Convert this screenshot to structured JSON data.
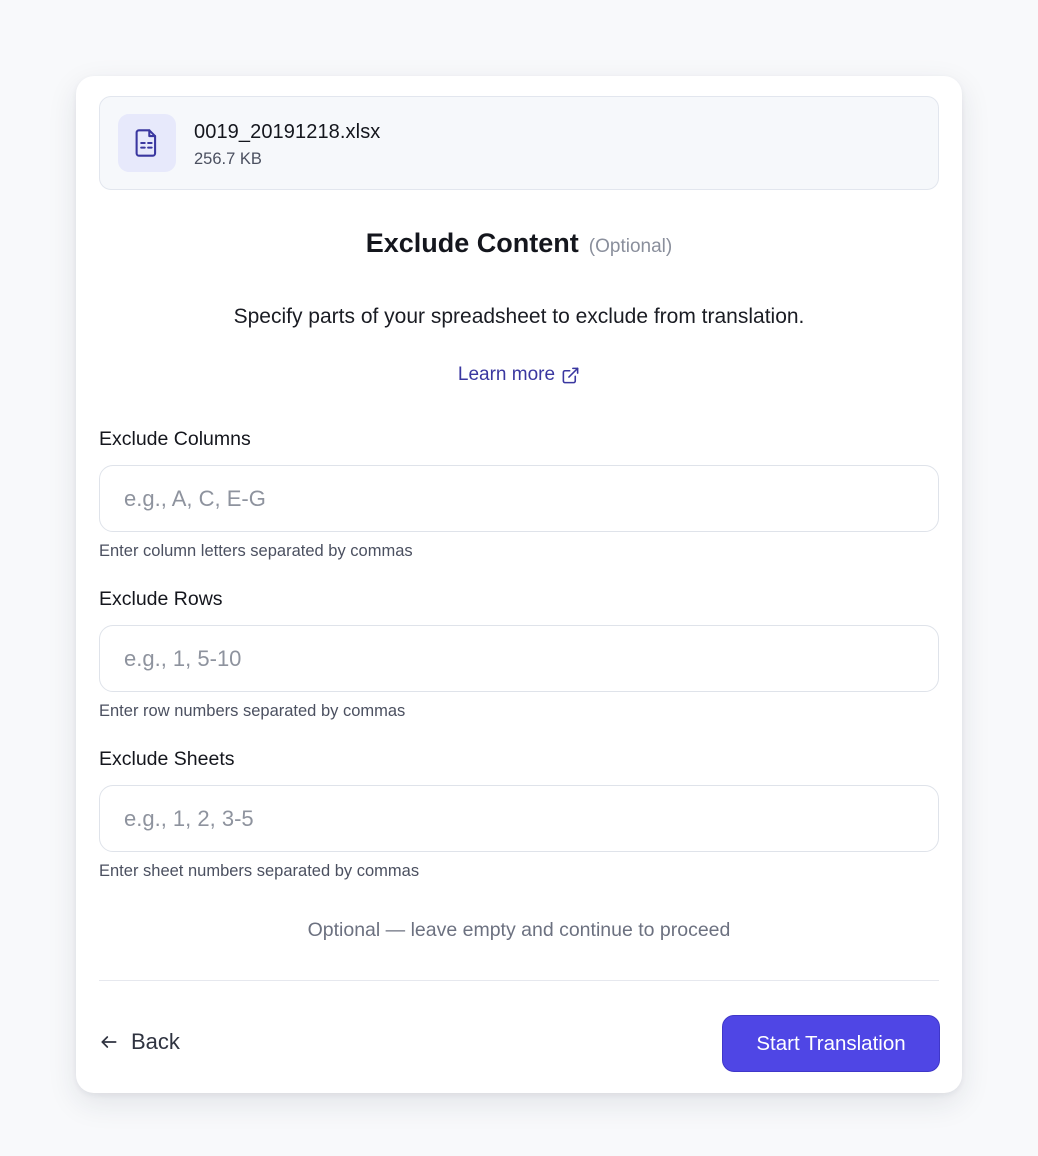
{
  "file": {
    "name": "0019_20191218.xlsx",
    "size": "256.7 KB",
    "icon": "spreadsheet-file-icon"
  },
  "heading": {
    "title": "Exclude Content",
    "optional_tag": "(Optional)"
  },
  "description": "Specify parts of your spreadsheet to exclude from translation.",
  "learn_more": {
    "label": "Learn more",
    "icon": "external-link-icon"
  },
  "fields": {
    "columns": {
      "label": "Exclude Columns",
      "placeholder": "e.g., A, C, E-G",
      "value": "",
      "help": "Enter column letters separated by commas"
    },
    "rows": {
      "label": "Exclude Rows",
      "placeholder": "e.g., 1, 5-10",
      "value": "",
      "help": "Enter row numbers separated by commas"
    },
    "sheets": {
      "label": "Exclude Sheets",
      "placeholder": "e.g., 1, 2, 3-5",
      "value": "",
      "help": "Enter sheet numbers separated by commas"
    }
  },
  "note": "Optional — leave empty and continue to proceed",
  "footer": {
    "back_label": "Back",
    "back_icon": "arrow-left-icon",
    "start_label": "Start Translation"
  },
  "colors": {
    "accent": "#4f46e5",
    "link": "#3a37a0",
    "icon_bg": "#e7e9fb"
  }
}
